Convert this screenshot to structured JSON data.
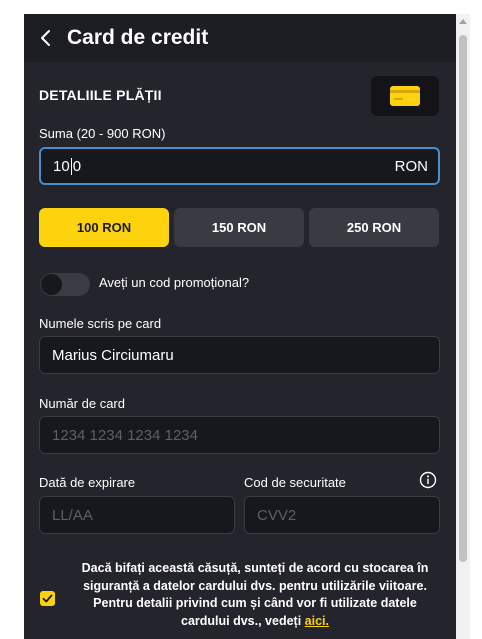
{
  "header": {
    "title": "Card de credit",
    "back_icon": "chevron-left-icon"
  },
  "payment": {
    "section_title": "DETALIILE PLĂȚII",
    "card_icon": "credit-card-icon",
    "amount_label": "Suma (20 - 900 RON)",
    "amount_value_before_caret": "10",
    "amount_value_after_caret": "0",
    "amount_suffix": "RON",
    "presets": [
      {
        "label": "100 RON",
        "selected": true
      },
      {
        "label": "150 RON",
        "selected": false
      },
      {
        "label": "250 RON",
        "selected": false
      }
    ],
    "promo_label": "Aveți un cod promoțional?",
    "promo_enabled": false
  },
  "card": {
    "name_label": "Numele scris pe card",
    "name_value": "Marius Circiumaru",
    "number_label": "Număr de card",
    "number_placeholder": "1234 1234 1234 1234",
    "expiry_label": "Dată de expirare",
    "expiry_placeholder": "LL/AA",
    "cvv_label": "Cod de securitate",
    "cvv_placeholder": "CVV2",
    "info_icon": "info-icon"
  },
  "consent": {
    "checked": true,
    "text": "Dacă bifați această căsuță, sunteți de acord cu stocarea în siguranță a datelor cardului dvs. pentru utilizările viitoare. Pentru detalii privind cum și când vor fi utilizate datele cardului dvs., vedeți ",
    "link": "aici."
  },
  "colors": {
    "accent": "#fcd30d",
    "panel": "#24252c",
    "field": "#17181d",
    "focus": "#4b8ec8"
  }
}
